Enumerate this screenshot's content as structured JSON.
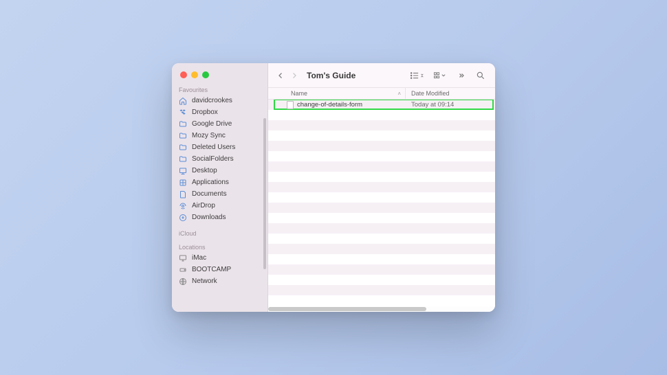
{
  "window": {
    "title": "Tom's Guide"
  },
  "sidebar": {
    "sections": [
      {
        "label": "Favourites",
        "items": [
          {
            "icon": "home",
            "label": "davidcrookes"
          },
          {
            "icon": "dropbox",
            "label": "Dropbox"
          },
          {
            "icon": "folder",
            "label": "Google Drive"
          },
          {
            "icon": "folder",
            "label": "Mozy Sync"
          },
          {
            "icon": "folder",
            "label": "Deleted Users"
          },
          {
            "icon": "folder",
            "label": "SocialFolders"
          },
          {
            "icon": "desktop",
            "label": "Desktop"
          },
          {
            "icon": "apps",
            "label": "Applications"
          },
          {
            "icon": "doc",
            "label": "Documents"
          },
          {
            "icon": "airdrop",
            "label": "AirDrop"
          },
          {
            "icon": "download",
            "label": "Downloads"
          }
        ]
      },
      {
        "label": "iCloud",
        "items": []
      },
      {
        "label": "Locations",
        "items": [
          {
            "icon": "imac",
            "label": "iMac"
          },
          {
            "icon": "disk",
            "label": "BOOTCAMP"
          },
          {
            "icon": "network",
            "label": "Network"
          }
        ]
      }
    ]
  },
  "columns": {
    "name": "Name",
    "date": "Date Modified"
  },
  "files": [
    {
      "name": "change-of-details-form",
      "date": "Today at 09:14",
      "selected": true
    }
  ]
}
